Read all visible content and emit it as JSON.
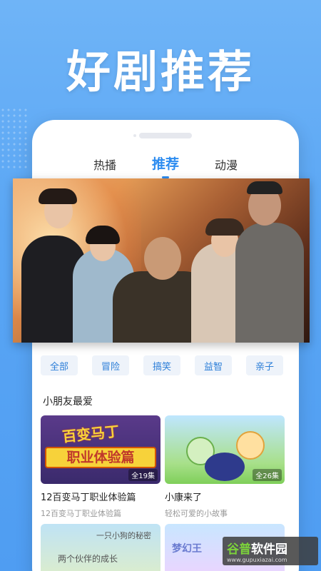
{
  "headline": "好剧推荐",
  "tabs": [
    {
      "label": "热播"
    },
    {
      "label": "推荐"
    },
    {
      "label": "动漫"
    }
  ],
  "categories": [
    "全部",
    "冒险",
    "搞笑",
    "益智",
    "亲子"
  ],
  "section_title": "小朋友最爱",
  "cards": [
    {
      "title": "12百变马丁职业体验篇",
      "subtitle": "12百变马丁职业体验篇",
      "episodes": "全19集",
      "thumb_text": "职业体验篇",
      "logo_text": "百变马丁"
    },
    {
      "title": "小康来了",
      "subtitle": "轻松可爱的小故事",
      "episodes": "全26集"
    }
  ],
  "bottom_cards": [
    {
      "thumb_text_1": "一只小狗的秘密",
      "thumb_text_2": "两个伙伴的成长"
    },
    {
      "thumb_text": "梦幻王"
    }
  ],
  "watermark": {
    "main_prefix": "谷普",
    "main_suffix": "软件园",
    "url": "www.gupuxiazai.com"
  },
  "colors": {
    "accent": "#2d8cf0",
    "background": "#5aa6f4"
  }
}
